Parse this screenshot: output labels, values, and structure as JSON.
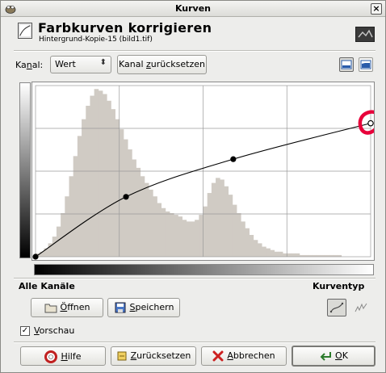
{
  "window": {
    "title": "Kurven"
  },
  "header": {
    "title": "Farbkurven korrigieren",
    "subtitle": "Hintergrund-Kopie-15 (bild1.tif)"
  },
  "channel": {
    "label_pre": "Ka",
    "label_underline": "n",
    "label_post": "al:",
    "value": "Wert",
    "reset_pre": "Kanal ",
    "reset_underline": "z",
    "reset_post": "urücksetzen"
  },
  "curve": {
    "points": [
      [
        0,
        0
      ],
      [
        0.27,
        0.35
      ],
      [
        0.59,
        0.57
      ],
      [
        1,
        0.78
      ]
    ],
    "histogram": [
      0.02,
      0.03,
      0.05,
      0.08,
      0.12,
      0.18,
      0.26,
      0.36,
      0.48,
      0.6,
      0.72,
      0.82,
      0.9,
      0.96,
      1.0,
      0.99,
      0.97,
      0.93,
      0.88,
      0.82,
      0.76,
      0.7,
      0.64,
      0.58,
      0.53,
      0.48,
      0.44,
      0.4,
      0.36,
      0.32,
      0.29,
      0.27,
      0.26,
      0.25,
      0.24,
      0.22,
      0.21,
      0.21,
      0.22,
      0.25,
      0.3,
      0.38,
      0.44,
      0.47,
      0.46,
      0.42,
      0.37,
      0.31,
      0.26,
      0.21,
      0.17,
      0.13,
      0.1,
      0.08,
      0.06,
      0.05,
      0.04,
      0.03,
      0.03,
      0.02,
      0.02,
      0.02,
      0.02,
      0.01,
      0.01,
      0.01,
      0.01,
      0.01,
      0.01,
      0.01,
      0.01,
      0.01,
      0.01,
      0.0,
      0.0,
      0.0,
      0.0,
      0.0,
      0.0,
      0.0
    ]
  },
  "sections": {
    "all_channels": "Alle Kanäle",
    "curve_type": "Kurventyp"
  },
  "buttons": {
    "open_underline": "Ö",
    "open_post": "ffnen",
    "save_underline": "S",
    "save_post": "peichern",
    "help_underline": "H",
    "help_post": "ilfe",
    "reset_underline": "Z",
    "reset_post": "urücksetzen",
    "cancel_underline": "A",
    "cancel_post": "bbrechen",
    "ok_underline": "O",
    "ok_post": "K"
  },
  "preview": {
    "checked": true,
    "label_underline": "V",
    "label_post": "orschau"
  },
  "colors": {
    "histogram": "#d0cbc4",
    "annotation": "#e8003a"
  }
}
